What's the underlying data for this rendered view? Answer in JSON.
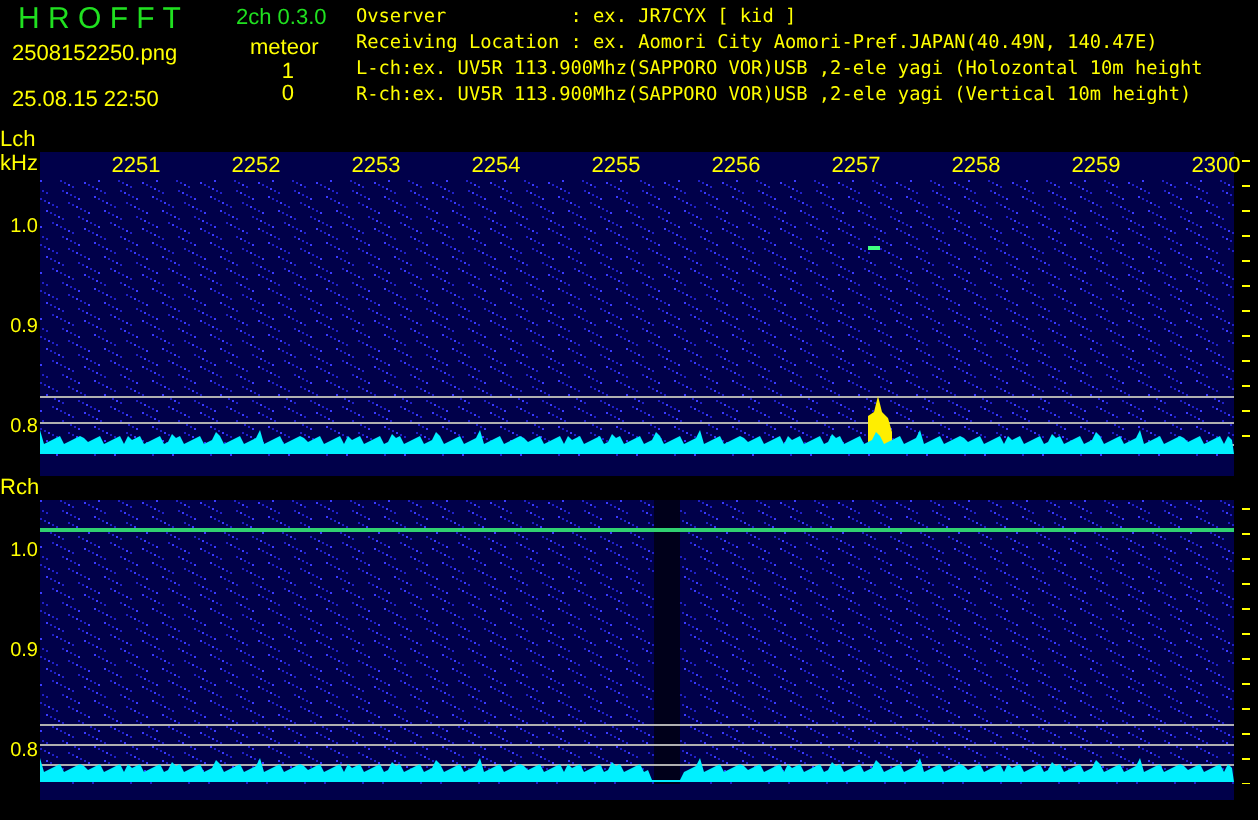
{
  "header": {
    "title": "H R O F F T",
    "filename": "2508152250.png",
    "datetime": "25.08.15 22:50",
    "version": "2ch 0.3.0",
    "counter_label": "meteor",
    "counts": [
      "1",
      "0"
    ],
    "info_lines": [
      "Ovserver           : ex. JR7CYX [ kid ]",
      "Receiving Location : ex. Aomori City Aomori-Pref.JAPAN(40.49N, 140.47E)",
      "L-ch:ex. UV5R 113.900Mhz(SAPPORO VOR)USB ,2-ele yagi (Holozontal 10m height",
      "R-ch:ex. UV5R 113.900Mhz(SAPPORO VOR)USB ,2-ele yagi (Vertical 10m height)"
    ]
  },
  "channels": [
    {
      "name": "Lch",
      "unit": "kHz",
      "kind": "burst",
      "time_ticks": [
        "2251",
        "2252",
        "2253",
        "2254",
        "2255",
        "2256",
        "2257",
        "2258",
        "2259",
        "2300"
      ],
      "y_labels": [
        "1.0",
        "0.9",
        "0.8"
      ]
    },
    {
      "name": "Rch",
      "kind": "carrier",
      "y_labels": [
        "1.0",
        "0.9",
        "0.8"
      ]
    }
  ]
}
